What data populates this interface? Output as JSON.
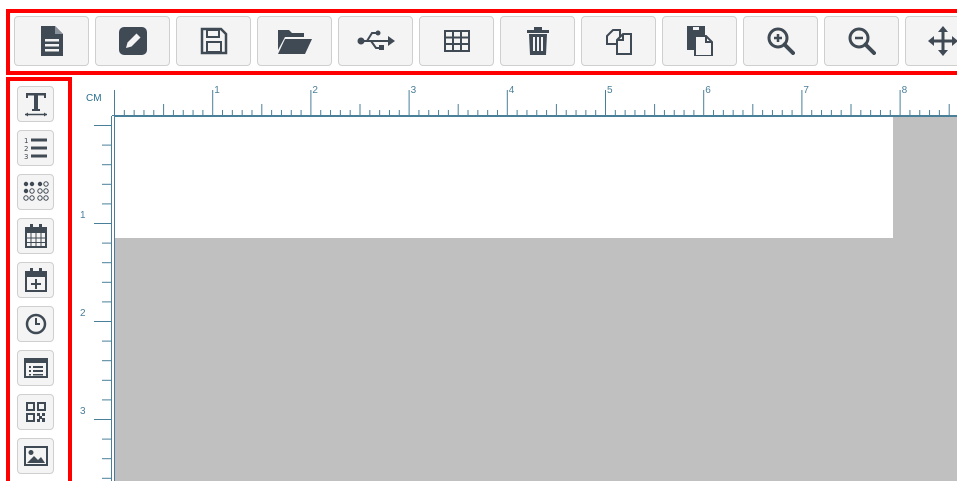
{
  "toolbar": {
    "buttons": [
      {
        "name": "new-document-icon"
      },
      {
        "name": "edit-icon"
      },
      {
        "name": "save-icon"
      },
      {
        "name": "open-folder-icon"
      },
      {
        "name": "usb-icon"
      },
      {
        "name": "table-icon"
      },
      {
        "name": "trash-icon"
      },
      {
        "name": "copy-icon"
      },
      {
        "name": "paste-icon"
      },
      {
        "name": "zoom-in-icon"
      },
      {
        "name": "zoom-out-icon"
      },
      {
        "name": "move-icon"
      }
    ]
  },
  "sidebar": {
    "tools": [
      {
        "name": "text-tool-icon"
      },
      {
        "name": "numbered-list-icon"
      },
      {
        "name": "braille-icon"
      },
      {
        "name": "calendar-icon"
      },
      {
        "name": "calendar-add-icon"
      },
      {
        "name": "clock-icon"
      },
      {
        "name": "list-box-icon"
      },
      {
        "name": "qr-code-icon"
      },
      {
        "name": "image-icon"
      }
    ]
  },
  "ruler": {
    "unit": "CM",
    "h_labels": [
      "1",
      "2",
      "3",
      "4",
      "5",
      "6",
      "7",
      "8"
    ],
    "v_labels": [
      "1",
      "2",
      "3"
    ]
  },
  "colors": {
    "frame_highlight": "#ff0000",
    "icon": "#3f4a55",
    "ruler": "#4a7f99",
    "workspace_gray": "#c0c0c0"
  }
}
